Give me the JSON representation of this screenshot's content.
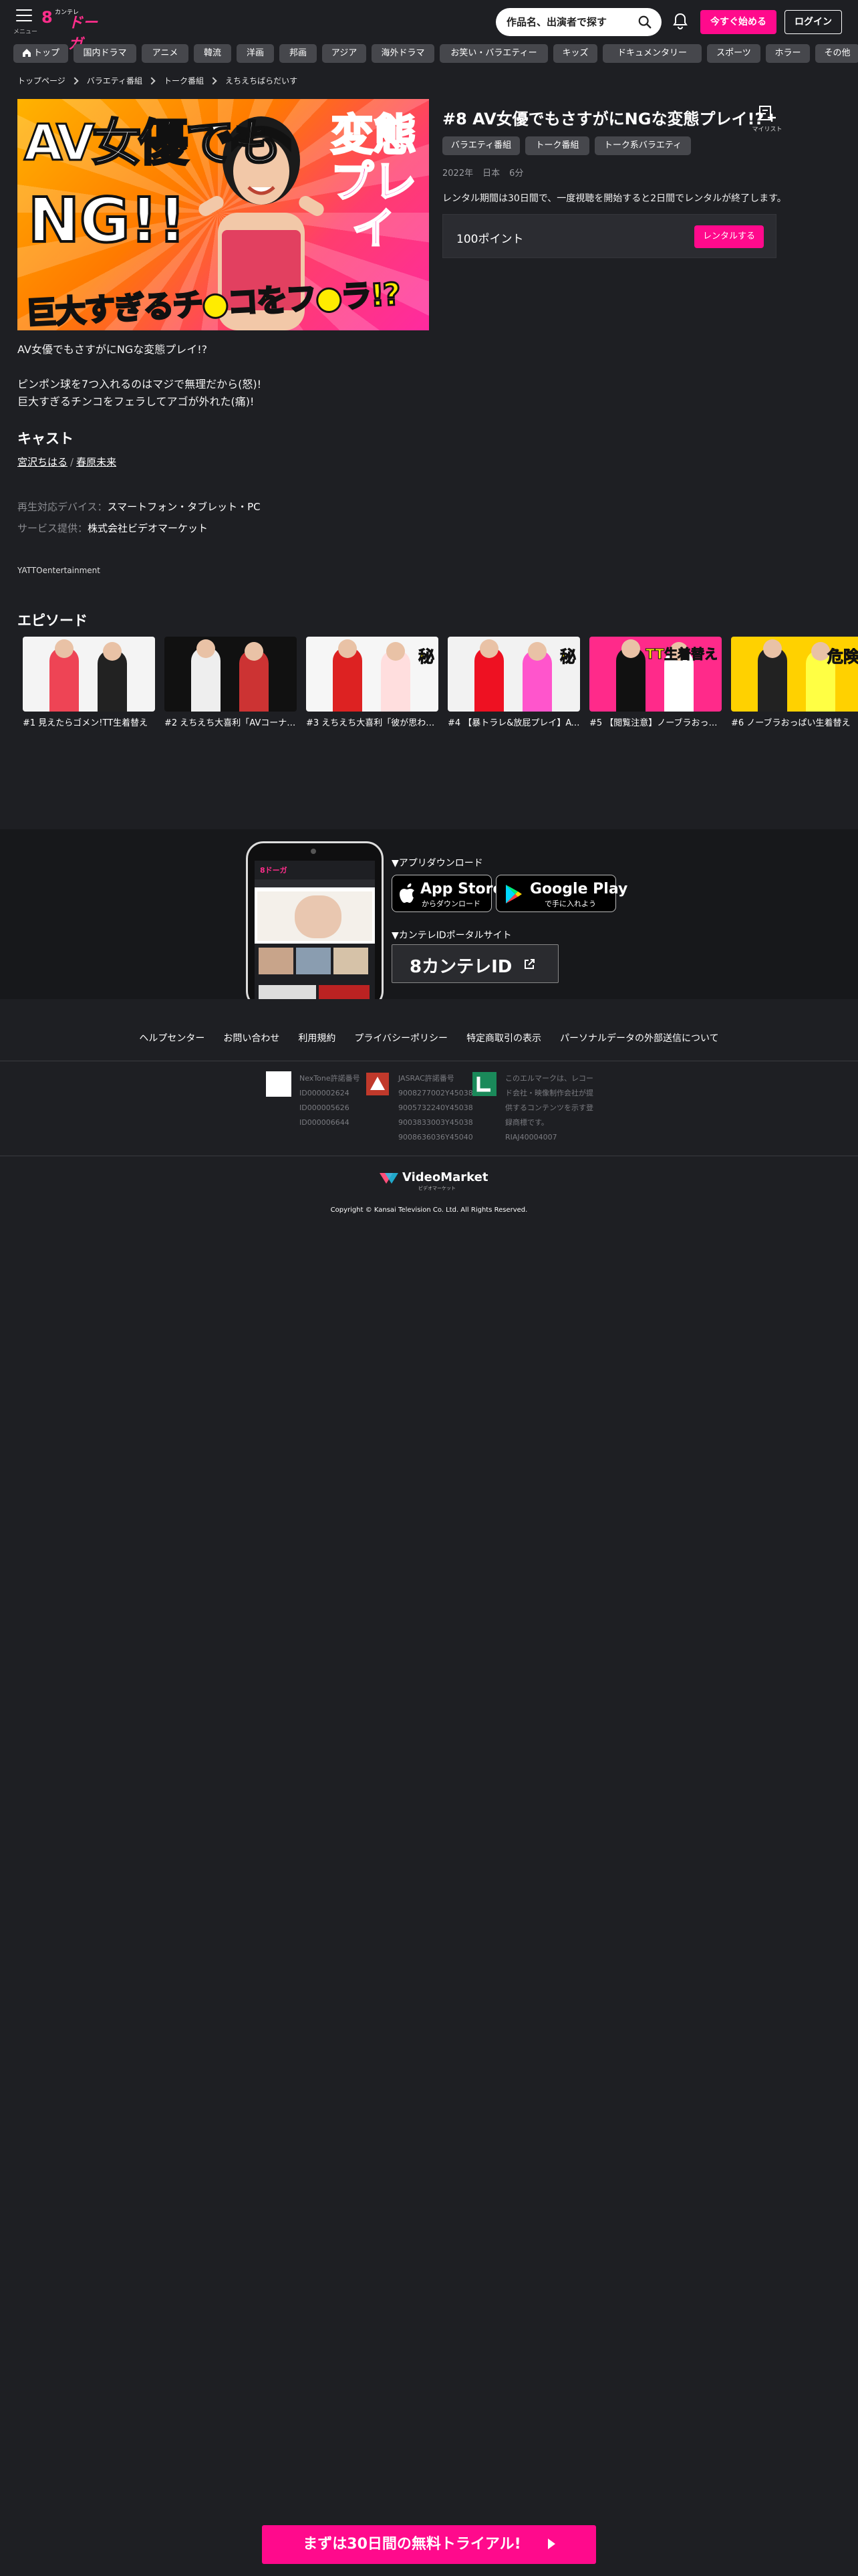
{
  "header": {
    "menu_label": "メニュー",
    "logo_kanji": "8",
    "logo_small": "カンテレ",
    "logo_text": "ドーガ",
    "search_placeholder": "作品名、出演者で探す",
    "trial_button": "今すぐ始める",
    "login_button": "ログイン"
  },
  "categories": [
    "トップ",
    "国内ドラマ",
    "アニメ",
    "韓流",
    "洋画",
    "邦画",
    "アジア",
    "海外ドラマ",
    "お笑い・バラエティー",
    "キッズ",
    "ドキュメンタリー",
    "スポーツ",
    "ホラー",
    "その他"
  ],
  "breadcrumb": [
    "トップページ",
    "バラエティ番組",
    "トーク番組",
    "えちえちばらだいす"
  ],
  "hero": {
    "line1": "AV女優でも",
    "line2": "NG!!",
    "line3": "変態プレイ",
    "line4": "巨大すぎるチ●コをフ●ラ!?"
  },
  "detail": {
    "title": "#8 AV女優でもさすがにNGな変態プレイ!?",
    "mylist_label": "マイリスト",
    "tags": [
      "バラエティ番組",
      "トーク番組",
      "トーク系バラエティ"
    ],
    "meta": {
      "year": "2022年",
      "country": "日本",
      "duration": "6分"
    },
    "rental_note": "レンタル期間は30日間で、一度視聴を開始すると2日間でレンタルが終了します。",
    "price": "100ポイント",
    "rent_button": "レンタルする"
  },
  "description": [
    "AV女優でもさすがにNGな変態プレイ!?",
    "ピンポン球を7つ入れるのはマジで無理だから(怒)!\n巨大すぎるチンコをフェラしてアゴが外れた(痛)!"
  ],
  "cast": {
    "heading": "キャスト",
    "names": [
      "宮沢ちはる",
      "春原未来"
    ],
    "divider": "/"
  },
  "info": {
    "device_label": "再生対応デバイス：",
    "device_value": "スマートフォン・タブレット・PC",
    "provider_label": "サービス提供：",
    "provider_value": "株式会社ビデオマーケット"
  },
  "copyright_small": "YATTOentertainment",
  "episodes": {
    "heading": "エピソード",
    "items": [
      {
        "caption": "#1 見えたらゴメン!TT生着替え",
        "colors": [
          "#f4f4f4",
          "#e45",
          "#222"
        ]
      },
      {
        "caption": "#2 えちえち大喜利「AVコーナー」",
        "colors": [
          "#111",
          "#eee",
          "#c33"
        ]
      },
      {
        "caption": "#3 えちえち大喜利「彼が思わず…」",
        "colors": [
          "#f6f6f6",
          "#d22",
          "#ffdede"
        ]
      },
      {
        "caption": "#4 【暴トラレ&放屁プレイ】AVを見",
        "colors": [
          "#f2f2f2",
          "#e12",
          "#f5c"
        ]
      },
      {
        "caption": "#5 【閲覧注意】ノーブラおっぱい",
        "colors": [
          "#ff2a8a",
          "#111",
          "#fff"
        ]
      },
      {
        "caption": "#6 ノーブラおっぱい生着替え",
        "colors": [
          "#ffd100",
          "#222",
          "#ff4"
        ]
      }
    ],
    "overlays": [
      "",
      "",
      "秘",
      "秘",
      "TT生着替え",
      "危険"
    ]
  },
  "app": {
    "download_heading": "▼アプリダウンロード",
    "app_store_small": "からダウンロード",
    "app_store_big": "App Store",
    "google_small": "で手に入れよう",
    "google_big": "Google Play",
    "portal_heading": "▼カンテレIDポータルサイト",
    "portal_label": "8カンテレID",
    "phone_logo": "8ドーガ"
  },
  "footer": {
    "links": [
      "ヘルプセンター",
      "お問い合わせ",
      "利用規約",
      "プライバシーポリシー",
      "特定商取引の表示",
      "パーソナルデータの外部送信について"
    ],
    "licenses": [
      {
        "lines": [
          "NexTone許諾番号",
          "ID000002624",
          "ID000005626",
          "ID000006644"
        ]
      },
      {
        "lines": [
          "JASRAC許諾番号",
          "9008277002Y45038",
          "9005732240Y45038",
          "9003833003Y45038",
          "9008636036Y45040"
        ]
      },
      {
        "lines": [
          "このエルマークは、レコー",
          "ド会社・映像制作会社が提",
          "供するコンテンツを示す登",
          "録商標です。",
          "RIAJ40004007"
        ]
      }
    ],
    "vm_name": "VideoMarket",
    "vm_sub": "ビデオマーケット",
    "copyright": "Copyright © Kansai Television Co. Ltd. All Rights Reserved."
  },
  "cta": "まずは30日間の無料トライアル!"
}
